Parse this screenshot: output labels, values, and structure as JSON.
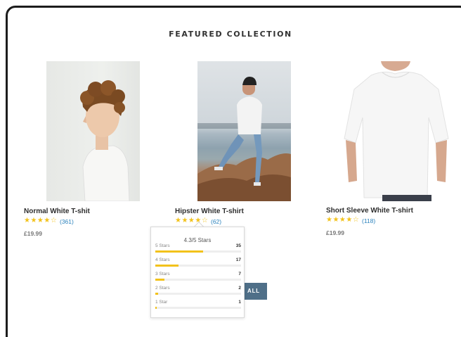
{
  "section": {
    "title": "FEATURED COLLECTION"
  },
  "colors": {
    "star": "#f2c21b",
    "link": "#2a82bd",
    "button": "#4f6f88"
  },
  "products": [
    {
      "name": "Normal White T-shit",
      "stars": "★★★★☆",
      "rating_value": 4,
      "reviews": "(361)",
      "price": "£19.99"
    },
    {
      "name": "Hipster White T-shirt",
      "stars": "★★★★☆",
      "rating_value": 4.3,
      "reviews": "(62)"
    },
    {
      "name": "Short Sleeve White T-shirt",
      "stars": "★★★★☆",
      "rating_value": 4,
      "reviews": "(118)",
      "price": "£19.99"
    }
  ],
  "view_all": {
    "label": "ALL"
  },
  "rating_popup": {
    "title": "4.3/5 Stars",
    "rows": [
      {
        "label": "5 Stars",
        "count": "35",
        "share": 0.56
      },
      {
        "label": "4 Stars",
        "count": "17",
        "share": 0.27
      },
      {
        "label": "3 Stars",
        "count": "7",
        "share": 0.11
      },
      {
        "label": "2 Stars",
        "count": "2",
        "share": 0.03
      },
      {
        "label": "1 Star",
        "count": "1",
        "share": 0.02
      }
    ]
  }
}
